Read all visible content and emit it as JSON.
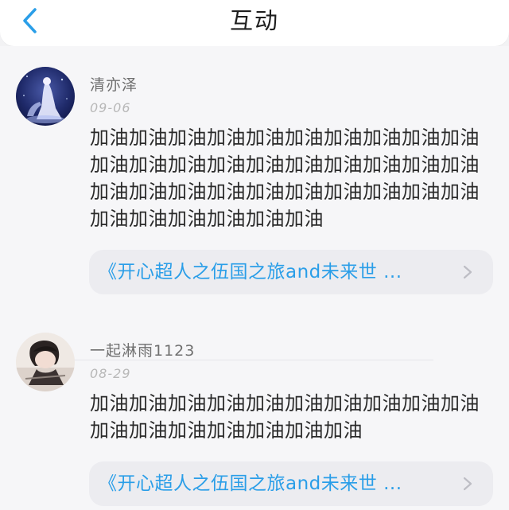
{
  "header": {
    "title": "互动",
    "back_icon": "chevron-left-icon",
    "accent_color": "#2a9ee8"
  },
  "feed": {
    "items": [
      {
        "username": "清亦泽",
        "date": "09-06",
        "comment": "加油加油加油加油加油加油加油加油加油加油加油加油加油加油加油加油加油加油加油加油加油加油加油加油加油加油加油加油加油加油加油加油加油加油加油加油",
        "link_text": "《开心超人之伍国之旅and未来世 ...",
        "link_icon": "chevron-right-icon"
      },
      {
        "username": "一起淋雨1123",
        "date": "08-29",
        "comment": "加油加油加油加油加油加油加油加油加油加油加油加油加油加油加油加油加油",
        "link_text": "《开心超人之伍国之旅and未来世 ...",
        "link_icon": "chevron-right-icon"
      }
    ]
  }
}
